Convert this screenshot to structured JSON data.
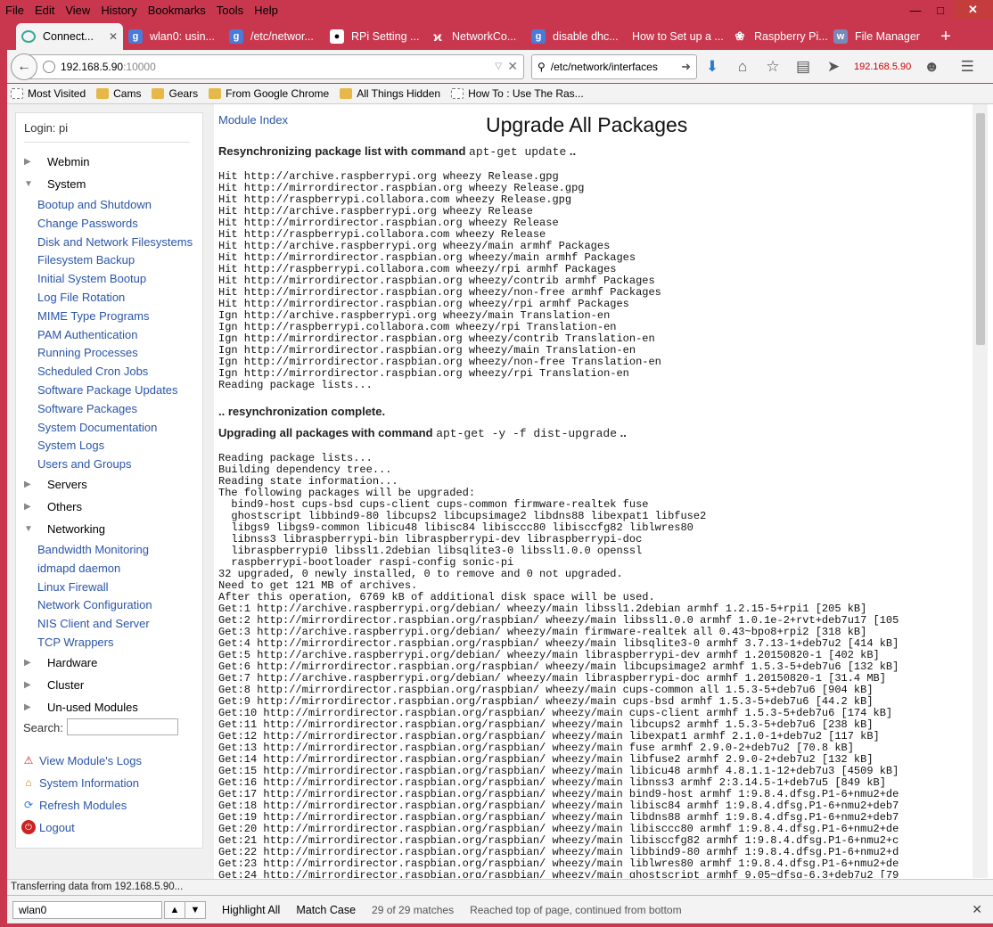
{
  "menu": [
    "File",
    "Edit",
    "View",
    "History",
    "Bookmarks",
    "Tools",
    "Help"
  ],
  "tabs": [
    {
      "label": "Connect...",
      "active": true
    },
    {
      "label": "wlan0: usin..."
    },
    {
      "label": "/etc/networ..."
    },
    {
      "label": "RPi Setting ..."
    },
    {
      "label": "NetworkCo..."
    },
    {
      "label": "disable dhc..."
    },
    {
      "label": "How to Set up a ..."
    },
    {
      "label": "Raspberry Pi..."
    },
    {
      "label": "File Manager"
    }
  ],
  "url": {
    "host": "192.168.5.90",
    "port": ":10000"
  },
  "search_box": "/etc/network/interfaces",
  "toolbar_ip": "192.168.5.90",
  "bookmarks": [
    "Most Visited",
    "Cams",
    "Gears",
    "From Google Chrome",
    "All Things Hidden",
    "How To : Use The Ras..."
  ],
  "sidebar": {
    "login": "Login: pi",
    "categories": {
      "webmin": "Webmin",
      "system": "System",
      "servers": "Servers",
      "others": "Others",
      "networking": "Networking",
      "hardware": "Hardware",
      "cluster": "Cluster",
      "unused": "Un-used Modules"
    },
    "system_items": [
      "Bootup and Shutdown",
      "Change Passwords",
      "Disk and Network Filesystems",
      "Filesystem Backup",
      "Initial System Bootup",
      "Log File Rotation",
      "MIME Type Programs",
      "PAM Authentication",
      "Running Processes",
      "Scheduled Cron Jobs",
      "Software Package Updates",
      "Software Packages",
      "System Documentation",
      "System Logs",
      "Users and Groups"
    ],
    "networking_items": [
      "Bandwidth Monitoring",
      "idmapd daemon",
      "Linux Firewall",
      "Network Configuration",
      "NIS Client and Server",
      "TCP Wrappers"
    ],
    "search_label": "Search:",
    "bottom_links": [
      "View Module's Logs",
      "System Information",
      "Refresh Modules",
      "Logout"
    ]
  },
  "main": {
    "module_index": "Module Index",
    "title": "Upgrade All Packages",
    "resync_label": "Resynchronizing package list with command",
    "resync_cmd": "apt-get update",
    "resync_tail": "..",
    "resync_output": "Hit http://archive.raspberrypi.org wheezy Release.gpg\nHit http://mirrordirector.raspbian.org wheezy Release.gpg\nHit http://raspberrypi.collabora.com wheezy Release.gpg\nHit http://archive.raspberrypi.org wheezy Release\nHit http://mirrordirector.raspbian.org wheezy Release\nHit http://raspberrypi.collabora.com wheezy Release\nHit http://archive.raspberrypi.org wheezy/main armhf Packages\nHit http://mirrordirector.raspbian.org wheezy/main armhf Packages\nHit http://raspberrypi.collabora.com wheezy/rpi armhf Packages\nHit http://mirrordirector.raspbian.org wheezy/contrib armhf Packages\nHit http://mirrordirector.raspbian.org wheezy/non-free armhf Packages\nHit http://mirrordirector.raspbian.org wheezy/rpi armhf Packages\nIgn http://archive.raspberrypi.org wheezy/main Translation-en\nIgn http://raspberrypi.collabora.com wheezy/rpi Translation-en\nIgn http://mirrordirector.raspbian.org wheezy/contrib Translation-en\nIgn http://mirrordirector.raspbian.org wheezy/main Translation-en\nIgn http://mirrordirector.raspbian.org wheezy/non-free Translation-en\nIgn http://mirrordirector.raspbian.org wheezy/rpi Translation-en\nReading package lists...",
    "resync_done": ".. resynchronization complete.",
    "upgrade_label": "Upgrading all packages with command",
    "upgrade_cmd": "apt-get -y -f dist-upgrade",
    "upgrade_tail": "..",
    "upgrade_output": "Reading package lists...\nBuilding dependency tree...\nReading state information...\nThe following packages will be upgraded:\n  bind9-host cups-bsd cups-client cups-common firmware-realtek fuse\n  ghostscript libbind9-80 libcups2 libcupsimage2 libdns88 libexpat1 libfuse2\n  libgs9 libgs9-common libicu48 libisc84 libisccc80 libisccfg82 liblwres80\n  libnss3 libraspberrypi-bin libraspberrypi-dev libraspberrypi-doc\n  libraspberrypi0 libssl1.2debian libsqlite3-0 libssl1.0.0 openssl\n  raspberrypi-bootloader raspi-config sonic-pi\n32 upgraded, 0 newly installed, 0 to remove and 0 not upgraded.\nNeed to get 121 MB of archives.\nAfter this operation, 6769 kB of additional disk space will be used.\nGet:1 http://archive.raspberrypi.org/debian/ wheezy/main libssl1.2debian armhf 1.2.15-5+rpi1 [205 kB]\nGet:2 http://mirrordirector.raspbian.org/raspbian/ wheezy/main libssl1.0.0 armhf 1.0.1e-2+rvt+deb7u17 [105\nGet:3 http://archive.raspberrypi.org/debian/ wheezy/main firmware-realtek all 0.43~bpo8+rpi2 [318 kB]\nGet:4 http://mirrordirector.raspbian.org/raspbian/ wheezy/main libsqlite3-0 armhf 3.7.13-1+deb7u2 [414 kB]\nGet:5 http://archive.raspberrypi.org/debian/ wheezy/main libraspberrypi-dev armhf 1.20150820-1 [402 kB]\nGet:6 http://mirrordirector.raspbian.org/raspbian/ wheezy/main libcupsimage2 armhf 1.5.3-5+deb7u6 [132 kB]\nGet:7 http://archive.raspberrypi.org/debian/ wheezy/main libraspberrypi-doc armhf 1.20150820-1 [31.4 MB]\nGet:8 http://mirrordirector.raspbian.org/raspbian/ wheezy/main cups-common all 1.5.3-5+deb7u6 [904 kB]\nGet:9 http://mirrordirector.raspbian.org/raspbian/ wheezy/main cups-bsd armhf 1.5.3-5+deb7u6 [44.2 kB]\nGet:10 http://mirrordirector.raspbian.org/raspbian/ wheezy/main cups-client armhf 1.5.3-5+deb7u6 [174 kB]\nGet:11 http://mirrordirector.raspbian.org/raspbian/ wheezy/main libcups2 armhf 1.5.3-5+deb7u6 [238 kB]\nGet:12 http://mirrordirector.raspbian.org/raspbian/ wheezy/main libexpat1 armhf 2.1.0-1+deb7u2 [117 kB]\nGet:13 http://mirrordirector.raspbian.org/raspbian/ wheezy/main fuse armhf 2.9.0-2+deb7u2 [70.8 kB]\nGet:14 http://mirrordirector.raspbian.org/raspbian/ wheezy/main libfuse2 armhf 2.9.0-2+deb7u2 [132 kB]\nGet:15 http://mirrordirector.raspbian.org/raspbian/ wheezy/main libicu48 armhf 4.8.1.1-12+deb7u3 [4509 kB]\nGet:16 http://mirrordirector.raspbian.org/raspbian/ wheezy/main libnss3 armhf 2:3.14.5-1+deb7u5 [849 kB]\nGet:17 http://mirrordirector.raspbian.org/raspbian/ wheezy/main bind9-host armhf 1:9.8.4.dfsg.P1-6+nmu2+de\nGet:18 http://mirrordirector.raspbian.org/raspbian/ wheezy/main libisc84 armhf 1:9.8.4.dfsg.P1-6+nmu2+deb7\nGet:19 http://mirrordirector.raspbian.org/raspbian/ wheezy/main libdns88 armhf 1:9.8.4.dfsg.P1-6+nmu2+deb7\nGet:20 http://mirrordirector.raspbian.org/raspbian/ wheezy/main libisccc80 armhf 1:9.8.4.dfsg.P1-6+nmu2+de\nGet:21 http://mirrordirector.raspbian.org/raspbian/ wheezy/main libisccfg82 armhf 1:9.8.4.dfsg.P1-6+nmu2+c\nGet:22 http://mirrordirector.raspbian.org/raspbian/ wheezy/main libbind9-80 armhf 1:9.8.4.dfsg.P1-6+nmu2+d\nGet:23 http://mirrordirector.raspbian.org/raspbian/ wheezy/main liblwres80 armhf 1:9.8.4.dfsg.P1-6+nmu2+de\nGet:24 http://mirrordirector.raspbian.org/raspbian/ wheezy/main ghostscript armhf 9.05~dfsg-6.3+deb7u2 [79"
  },
  "status": "Transferring data from 192.168.5.90...",
  "findbar": {
    "query": "wlan0",
    "highlight_all": "Highlight All",
    "match_case": "Match Case",
    "matches": "29 of 29 matches",
    "message": "Reached top of page, continued from bottom"
  }
}
